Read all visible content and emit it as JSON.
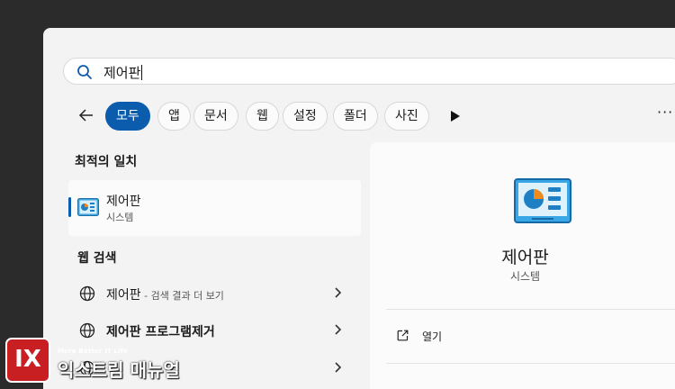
{
  "search": {
    "query": "제어판"
  },
  "filters": {
    "back_label": "←",
    "chips": [
      "모두",
      "앱",
      "문서",
      "웹",
      "설정",
      "폴더",
      "사진"
    ],
    "more_label": "···"
  },
  "left": {
    "best_match_heading": "최적의 일치",
    "best_match": {
      "title": "제어판",
      "subtitle": "시스템"
    },
    "web_heading": "웹 검색",
    "web_items": [
      {
        "label": "제어판",
        "suffix": " - 검색 결과 더 보기"
      },
      {
        "label": "제어판 프로그램제거",
        "suffix": ""
      },
      {
        "label": "",
        "suffix": ""
      }
    ]
  },
  "detail": {
    "title": "제어판",
    "subtitle": "시스템",
    "actions": [
      {
        "label": "열기"
      }
    ]
  },
  "watermark": {
    "badge": "IX",
    "tagline": "More Better IT Life",
    "name": "익스트림 매뉴얼"
  },
  "colors": {
    "accent": "#0b5cad",
    "panel": "#f3f3f3",
    "brand_red": "#c81f23"
  },
  "icons": [
    "search-icon",
    "back-arrow-icon",
    "play-icon",
    "more-icon",
    "control-panel-icon",
    "globe-icon",
    "chevron-right-icon",
    "open-external-icon"
  ]
}
